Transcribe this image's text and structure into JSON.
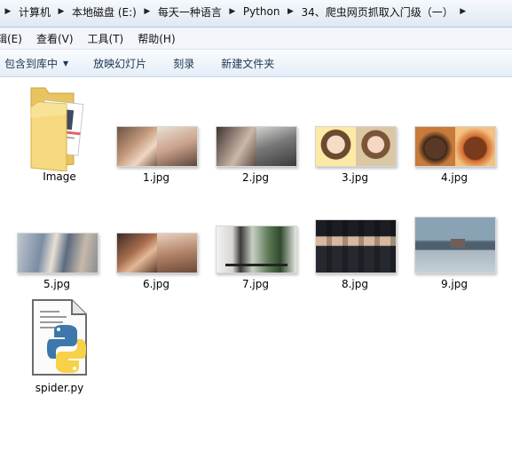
{
  "address": {
    "crumbs": [
      "计算机",
      "本地磁盘 (E:)",
      "每天一种语言",
      "Python",
      "34、爬虫网页抓取入门级（一）"
    ]
  },
  "menu": {
    "items": [
      "编辑(E)",
      "查看(V)",
      "工具(T)",
      "帮助(H)"
    ]
  },
  "toolbar": {
    "include_label": "包含到库中",
    "slideshow_label": "放映幻灯片",
    "burn_label": "刻录",
    "new_folder_label": "新建文件夹"
  },
  "files": [
    {
      "name": "Image",
      "type": "folder"
    },
    {
      "name": "1.jpg",
      "type": "image"
    },
    {
      "name": "2.jpg",
      "type": "image"
    },
    {
      "name": "3.jpg",
      "type": "image"
    },
    {
      "name": "4.jpg",
      "type": "image"
    },
    {
      "name": "5.jpg",
      "type": "image"
    },
    {
      "name": "6.jpg",
      "type": "image"
    },
    {
      "name": "7.jpg",
      "type": "image"
    },
    {
      "name": "8.jpg",
      "type": "image"
    },
    {
      "name": "9.jpg",
      "type": "image"
    },
    {
      "name": "spider.py",
      "type": "python"
    }
  ],
  "colors": {
    "folder": "#f3d480",
    "python_blue": "#3d77ab",
    "python_yellow": "#f7d147"
  }
}
